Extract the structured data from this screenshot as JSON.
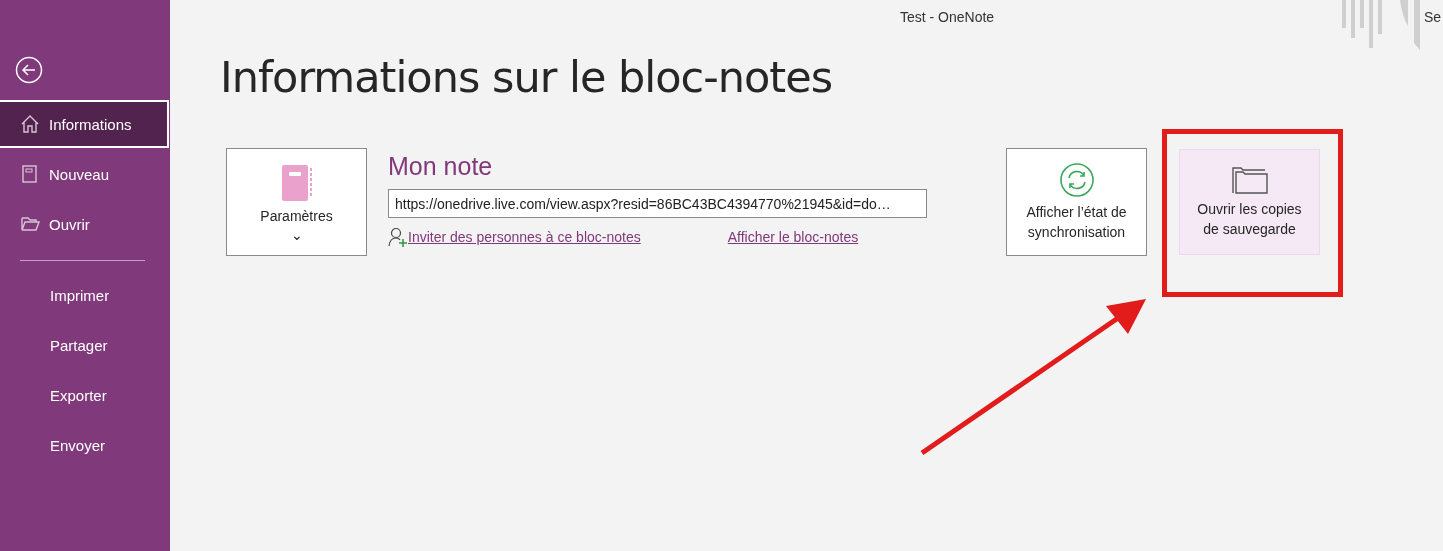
{
  "window": {
    "title": "Test  -  OneNote",
    "account_label": "Se"
  },
  "sidebar": {
    "groups": [
      [
        {
          "label": "Informations",
          "kind": "home",
          "selected": true
        },
        {
          "label": "Nouveau",
          "kind": "notebook",
          "selected": false
        },
        {
          "label": "Ouvrir",
          "kind": "folder",
          "selected": false
        }
      ],
      [
        {
          "label": "Imprimer",
          "selected": false
        },
        {
          "label": "Partager",
          "selected": false
        },
        {
          "label": "Exporter",
          "selected": false
        },
        {
          "label": "Envoyer",
          "selected": false
        }
      ]
    ]
  },
  "heading": "Informations sur le bloc-notes",
  "settings_button": {
    "label": "Paramètres",
    "caret": "⌄"
  },
  "notebook": {
    "name": "Mon note",
    "url": "https://onedrive.live.com/view.aspx?resid=86BC43BC4394770%21945&id=do…",
    "invite_link": "Inviter des personnes à ce bloc-notes",
    "view_link": "Afficher le bloc-notes"
  },
  "actions": [
    {
      "label": "Afficher l’état de synchronisation",
      "kind": "sync",
      "selected": false
    },
    {
      "label": "Ouvrir les copies de sauvegarde",
      "kind": "backup",
      "selected": true
    }
  ]
}
